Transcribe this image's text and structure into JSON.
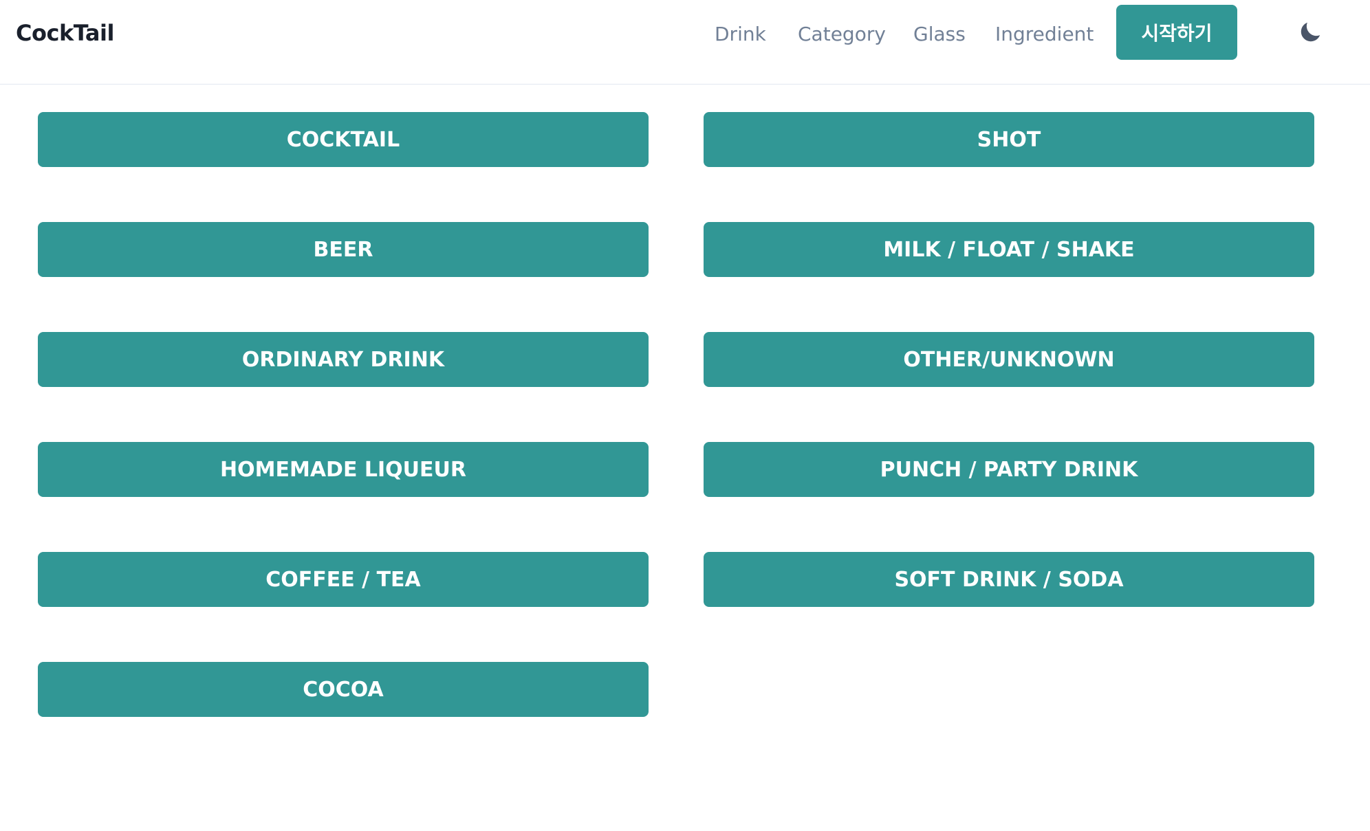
{
  "header": {
    "brand": "CockTail",
    "nav": [
      "Drink",
      "Category",
      "Glass",
      "Ingredient"
    ],
    "start_label": "시작하기",
    "theme_icon": "moon-icon"
  },
  "categories": [
    "COCKTAIL",
    "SHOT",
    "BEER",
    "MILK / FLOAT / SHAKE",
    "ORDINARY DRINK",
    "OTHER/UNKNOWN",
    "HOMEMADE LIQUEUR",
    "PUNCH / PARTY DRINK",
    "COFFEE / TEA",
    "SOFT DRINK / SODA",
    "COCOA"
  ],
  "colors": {
    "accent": "#319795",
    "nav_text": "#718096",
    "brand_text": "#1a202c",
    "icon": "#4a5568"
  }
}
